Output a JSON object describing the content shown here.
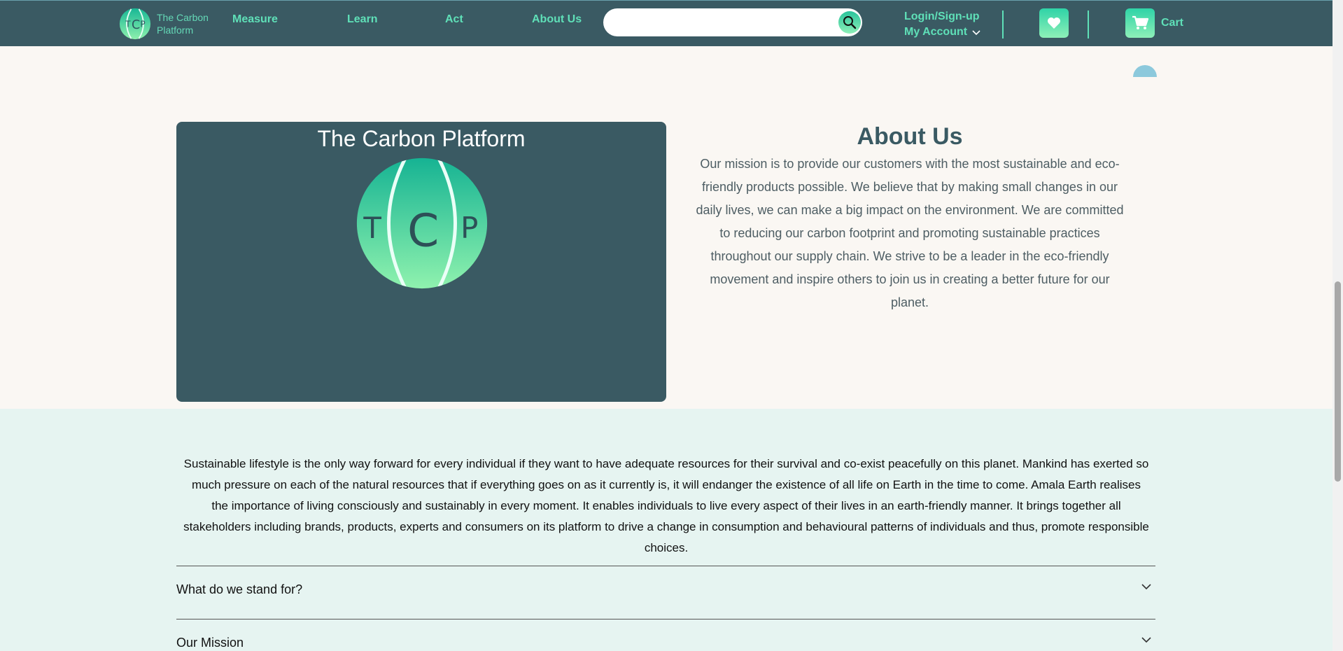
{
  "brand": {
    "name_line1": "The Carbon",
    "name_line2": "Platform"
  },
  "nav": {
    "measure": "Measure",
    "learn": "Learn",
    "act": "Act",
    "about": "About Us"
  },
  "search": {
    "placeholder": "",
    "value": ""
  },
  "account": {
    "login": "Login/Sign-up",
    "my_account": "My Account"
  },
  "cart": {
    "label": "Cart"
  },
  "about": {
    "card_title": "The Carbon Platform",
    "logo_letters": [
      "T",
      "C",
      "P"
    ],
    "heading": "About Us",
    "body": "Our mission is to provide our customers with the most sustainable and eco-friendly products possible. We believe that by making small changes in our daily lives, we can make a big impact on the environment. We are committed to reducing our carbon footprint and promoting sustainable practices throughout our supply chain. We strive to be a leader in the eco-friendly movement and inspire others to join us in creating a better future for our planet."
  },
  "intro": "Sustainable lifestyle is the only way forward for every individual if they want to have adequate resources for their survival and co-exist peacefully on this planet. Mankind has exerted so much pressure on each of the natural resources that if everything goes on as it currently is, it will endanger the existence of all life on Earth in the time to come. Amala Earth realises the importance of living consciously and sustainably in every moment. It enables individuals to live every aspect of their lives in an earth-friendly manner. It brings together all stakeholders including brands, products, experts and consumers on its platform to drive a change in consumption and behavioural patterns of individuals and thus, promote responsible choices.",
  "faq": [
    {
      "title": "What do we stand for?"
    },
    {
      "title": "Our Mission"
    }
  ],
  "colors": {
    "nav_bg": "#3a5a63",
    "accent": "#5fe0b8",
    "page_bg": "#faf7f3",
    "mint_bg": "#e6f4f1"
  }
}
